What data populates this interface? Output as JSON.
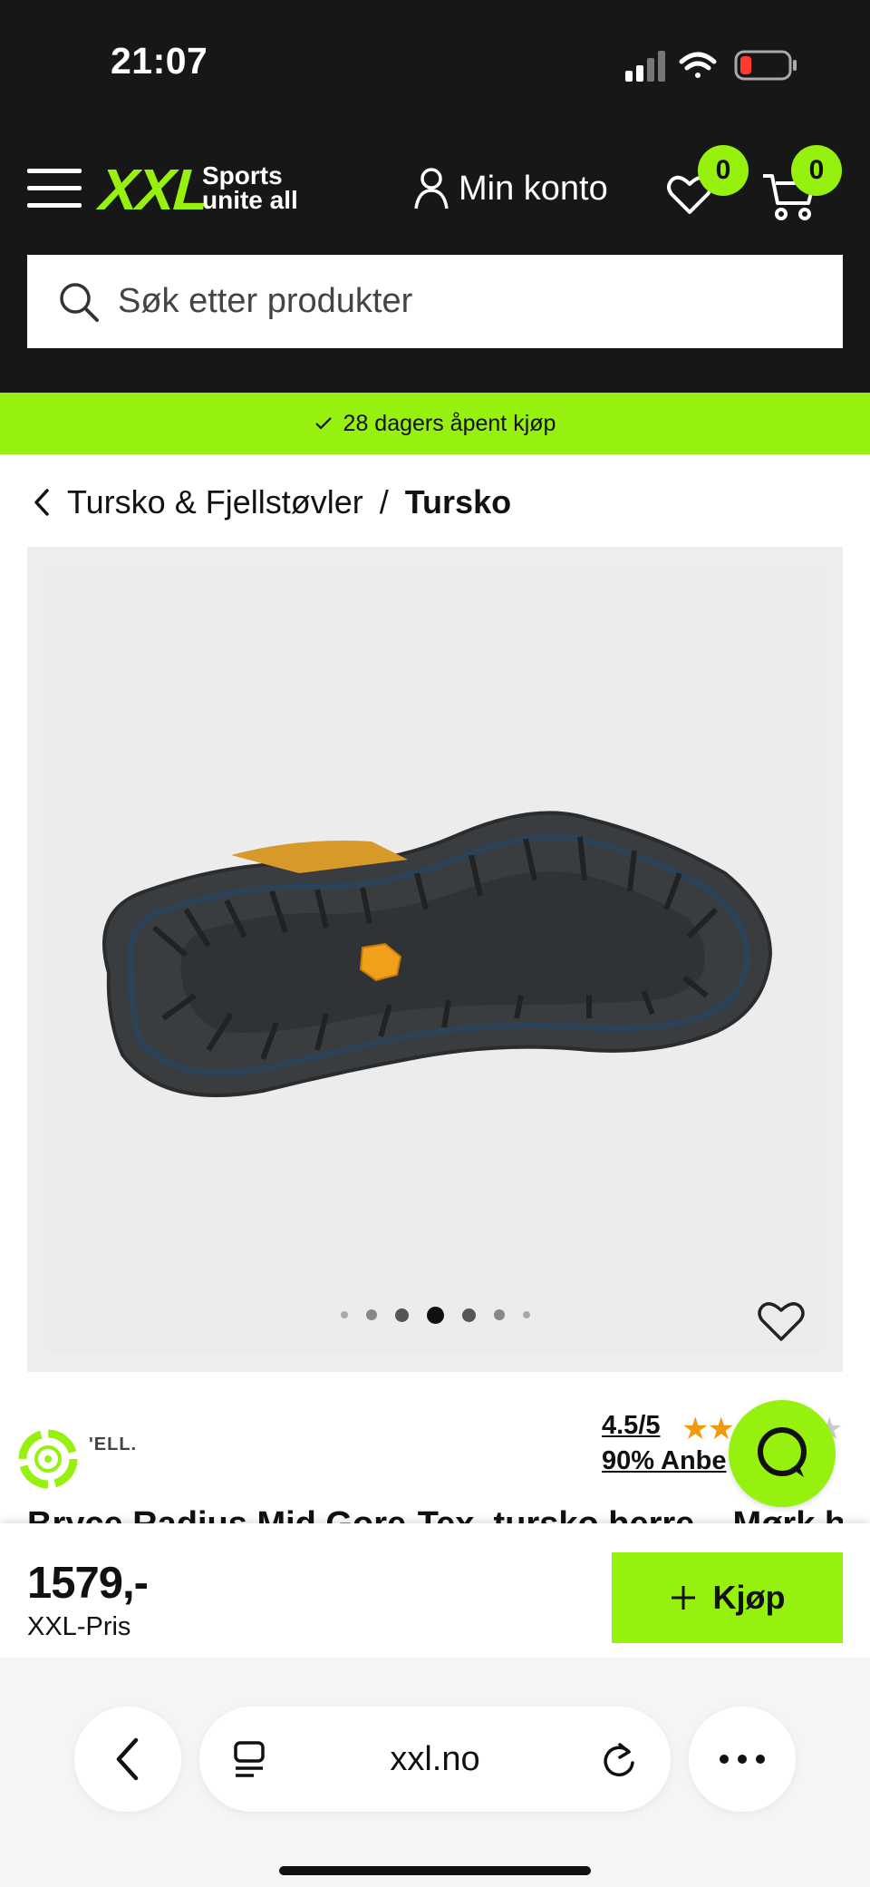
{
  "status_bar": {
    "time": "21:07"
  },
  "header": {
    "logo": "XXL",
    "tagline_line1": "Sports",
    "tagline_line2": "unite all",
    "account_label": "Min konto",
    "wishlist_count": "0",
    "cart_count": "0"
  },
  "search": {
    "placeholder": "Søk etter produkter"
  },
  "promo": {
    "text": "28 dagers åpent kjøp"
  },
  "breadcrumb": {
    "parent": "Tursko & Fjellstøvler",
    "separator": "/",
    "current": "Tursko"
  },
  "gallery": {
    "image_count": 7,
    "active_index": 3
  },
  "brand": {
    "name_fragment": "'ELL."
  },
  "rating": {
    "score": "4.5/5",
    "stars_filled": 2,
    "recommend": "90% Anbe"
  },
  "product": {
    "title_fragment": "Bryce Radius Mid Gore-Tex, tursko herre – Mørk blå"
  },
  "buy": {
    "price": "1579,-",
    "price_label": "XXL-Pris",
    "button_label": "Kjøp"
  },
  "browser": {
    "url": "xxl.no"
  },
  "colors": {
    "brand_green": "#97f10e",
    "header_dark": "#171717",
    "star": "#f29a0f"
  }
}
